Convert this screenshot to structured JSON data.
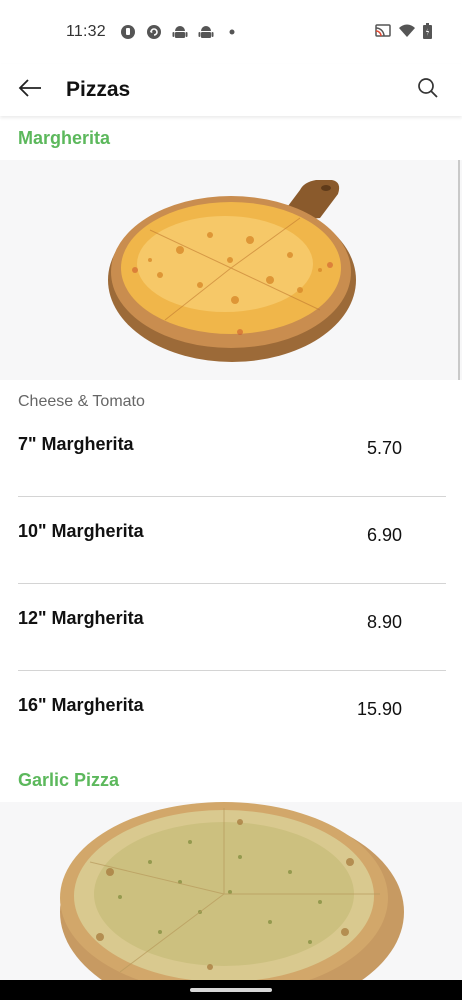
{
  "status_bar": {
    "time": "11:32",
    "notification_icons": [
      "app-notification-icon",
      "sync-icon",
      "android-icon",
      "android-icon",
      "more-dot-icon"
    ],
    "system_icons": [
      "cast-icon",
      "wifi-icon",
      "battery-icon"
    ]
  },
  "app_bar": {
    "title": "Pizzas",
    "back_icon": "arrow-left-icon",
    "search_icon": "search-icon"
  },
  "sections": [
    {
      "title": "Margherita",
      "image": "margherita-pizza-image",
      "subtitle": "Cheese & Tomato",
      "items": [
        {
          "name": "7\" Margherita",
          "price": "5.70"
        },
        {
          "name": "10\" Margherita",
          "price": "6.90"
        },
        {
          "name": "12\" Margherita",
          "price": "8.90"
        },
        {
          "name": "16\" Margherita",
          "price": "15.90"
        }
      ]
    },
    {
      "title": "Garlic Pizza",
      "image": "garlic-pizza-image"
    }
  ],
  "colors": {
    "accent": "#5cb85c",
    "divider": "#d4d4d4",
    "panel_bg": "#f7f7f8"
  }
}
